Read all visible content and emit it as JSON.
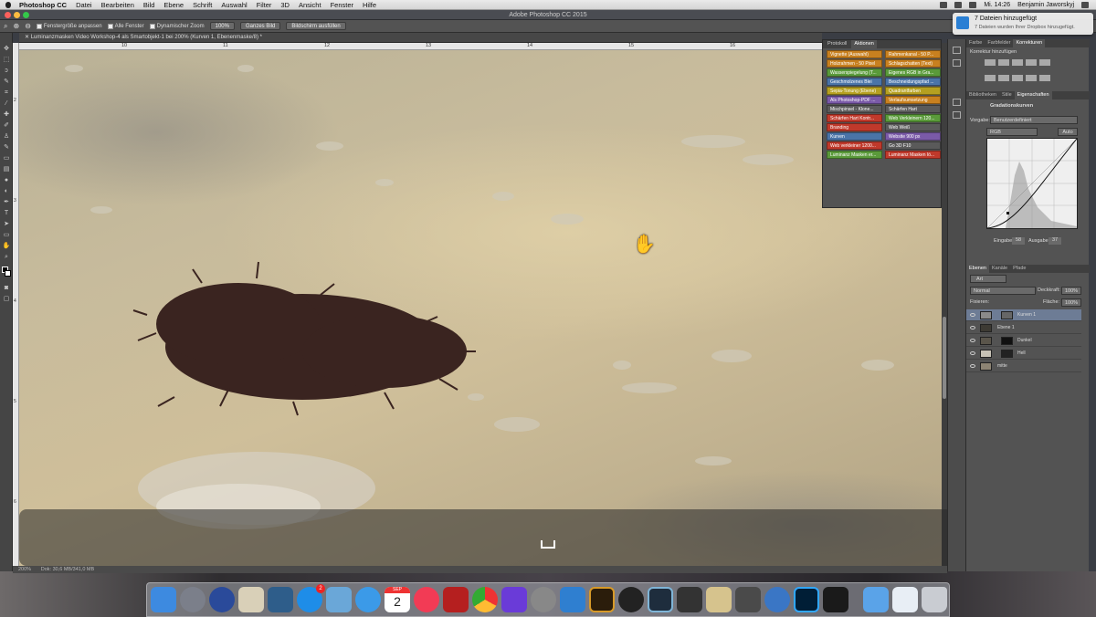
{
  "menubar": {
    "items": [
      "Photoshop CC",
      "Datei",
      "Bearbeiten",
      "Bild",
      "Ebene",
      "Schrift",
      "Auswahl",
      "Filter",
      "3D",
      "Ansicht",
      "Fenster",
      "Hilfe"
    ],
    "clock": "Mi. 14:26",
    "user": "Benjamin Jaworskyj"
  },
  "window": {
    "title": "Adobe Photoshop CC 2015"
  },
  "optionsbar": {
    "chk1": "Fenstergröße anpassen",
    "chk2": "Alle Fenster",
    "chk3": "Dynamischer Zoom",
    "zoom": "100%",
    "btn1": "Ganzes Bild",
    "btn2": "Bildschirm ausfüllen"
  },
  "document": {
    "tab": "Luminanzmasken Video Workshop-4 als Smartobjekt-1 bei 200% (Kurven 1, Ebenenmaske/8) *",
    "ruler_top": [
      "10",
      "11",
      "12",
      "13",
      "14",
      "15",
      "16"
    ],
    "ruler_left": [
      "2",
      "3",
      "4",
      "5",
      "6"
    ],
    "zoom_status": "200%",
    "doc_status": "Dok: 30,6 MB/341,0 MB"
  },
  "actions_panel": {
    "tabs": [
      "Protokoll",
      "Aktionen"
    ],
    "items": [
      {
        "label": "Vignette (Auswahl)",
        "color": "#c8801f"
      },
      {
        "label": "Rahmenkanal - 50 P...",
        "color": "#c8801f"
      },
      {
        "label": "Holzrahmen - 50 Pixel",
        "color": "#c8801f"
      },
      {
        "label": "Schlagschatten (Text)",
        "color": "#c8801f"
      },
      {
        "label": "Wasserspiegelung (T...",
        "color": "#5a9a3a"
      },
      {
        "label": "Eigenes RGB in Gra...",
        "color": "#5a9a3a"
      },
      {
        "label": "Geschmolzenes Blei",
        "color": "#4a74a8"
      },
      {
        "label": "Beschneidungspfad ...",
        "color": "#4a74a8"
      },
      {
        "label": "Sepia-Tonung (Ebene)",
        "color": "#b5a020"
      },
      {
        "label": "Quadrantfarben",
        "color": "#b5a020"
      },
      {
        "label": "Als Photoshop-PDF ...",
        "color": "#7a5aa8"
      },
      {
        "label": "Verlaufsumsetzung",
        "color": "#c8801f"
      },
      {
        "label": "Mischpinsel - Klone...",
        "color": "#5a5a5a"
      },
      {
        "label": "Schärfen Hart",
        "color": "#5a5a5a"
      },
      {
        "label": "Schärfen Hart Kontr...",
        "color": "#c0392b"
      },
      {
        "label": "Web Verkleinern 120...",
        "color": "#5a9a3a"
      },
      {
        "label": "Branding",
        "color": "#c0392b"
      },
      {
        "label": "Web Weiß",
        "color": "#5a5a5a"
      },
      {
        "label": "Kurven",
        "color": "#4a74a8"
      },
      {
        "label": "Website 900 px",
        "color": "#7a5aa8"
      },
      {
        "label": "Web verkleiner 1200...",
        "color": "#c0392b"
      },
      {
        "label": "Go 3D          F10",
        "color": "#5a5a5a"
      },
      {
        "label": "Luminanz Masken er...",
        "color": "#5a9a3a"
      },
      {
        "label": "Luminanz Masken lö...",
        "color": "#c0392b"
      }
    ]
  },
  "right_panel": {
    "tabs1": [
      "Farbe",
      "Farbfelder",
      "Korrekturen"
    ],
    "korrektur_label": "Korrektur hinzufügen",
    "tabs2": [
      "Bibliotheken",
      "Stile",
      "Eigenschaften"
    ],
    "props_title": "Gradationskurven",
    "vorgabe_label": "Vorgabe:",
    "vorgabe_value": "Benutzerdefiniert",
    "channel": "RGB",
    "auto": "Auto",
    "eingabe_label": "Eingabe:",
    "eingabe_value": "58",
    "ausgabe_label": "Ausgabe:",
    "ausgabe_value": "37",
    "tabs3": [
      "Ebenen",
      "Kanäle",
      "Pfade"
    ],
    "filter_kind": "Art",
    "blend_mode": "Normal",
    "opacity_label": "Deckkraft:",
    "opacity_value": "100%",
    "lock_label": "Fixieren:",
    "fill_label": "Fläche:",
    "fill_value": "100%",
    "layers": [
      "Kurven 1",
      "Ebene 1",
      "Dunkel",
      "Hell",
      "mitte"
    ]
  },
  "notification": {
    "title": "7 Dateien hinzugefügt",
    "body": "7 Dateien wurden Ihrer Dropbox hinzugefügt."
  },
  "dock": {
    "badge": "2",
    "calendar_month": "SEP",
    "calendar_day": "2"
  }
}
